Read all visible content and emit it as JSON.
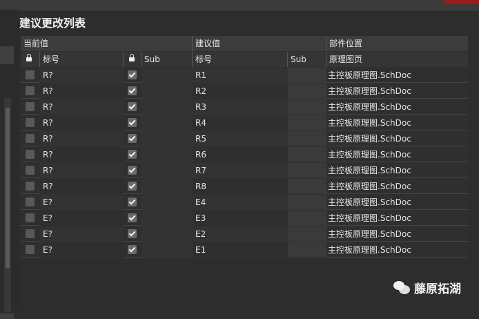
{
  "panel": {
    "title": "建议更改列表"
  },
  "groups": {
    "current": "当前值",
    "suggested": "建议值",
    "location": "部件位置"
  },
  "headers": {
    "designator": "标号",
    "sub": "Sub",
    "designator2": "标号",
    "sub2": "Sub",
    "sheet": "原理图页"
  },
  "rows": [
    {
      "current": "R?",
      "suggested": "R1",
      "sheet": "主控板原理图.SchDoc",
      "locked": false,
      "checked": true
    },
    {
      "current": "R?",
      "suggested": "R2",
      "sheet": "主控板原理图.SchDoc",
      "locked": false,
      "checked": true
    },
    {
      "current": "R?",
      "suggested": "R3",
      "sheet": "主控板原理图.SchDoc",
      "locked": false,
      "checked": true
    },
    {
      "current": "R?",
      "suggested": "R4",
      "sheet": "主控板原理图.SchDoc",
      "locked": false,
      "checked": true
    },
    {
      "current": "R?",
      "suggested": "R5",
      "sheet": "主控板原理图.SchDoc",
      "locked": false,
      "checked": true
    },
    {
      "current": "R?",
      "suggested": "R6",
      "sheet": "主控板原理图.SchDoc",
      "locked": false,
      "checked": true
    },
    {
      "current": "R?",
      "suggested": "R7",
      "sheet": "主控板原理图.SchDoc",
      "locked": false,
      "checked": true
    },
    {
      "current": "R?",
      "suggested": "R8",
      "sheet": "主控板原理图.SchDoc",
      "locked": false,
      "checked": true
    },
    {
      "current": "E?",
      "suggested": "E4",
      "sheet": "主控板原理图.SchDoc",
      "locked": false,
      "checked": true
    },
    {
      "current": "E?",
      "suggested": "E3",
      "sheet": "主控板原理图.SchDoc",
      "locked": false,
      "checked": true
    },
    {
      "current": "E?",
      "suggested": "E2",
      "sheet": "主控板原理图.SchDoc",
      "locked": false,
      "checked": true
    },
    {
      "current": "E?",
      "suggested": "E1",
      "sheet": "主控板原理图.SchDoc",
      "locked": false,
      "checked": true
    }
  ],
  "watermark": {
    "text": "藤原拓湖",
    "icon": "wechat-icon"
  }
}
